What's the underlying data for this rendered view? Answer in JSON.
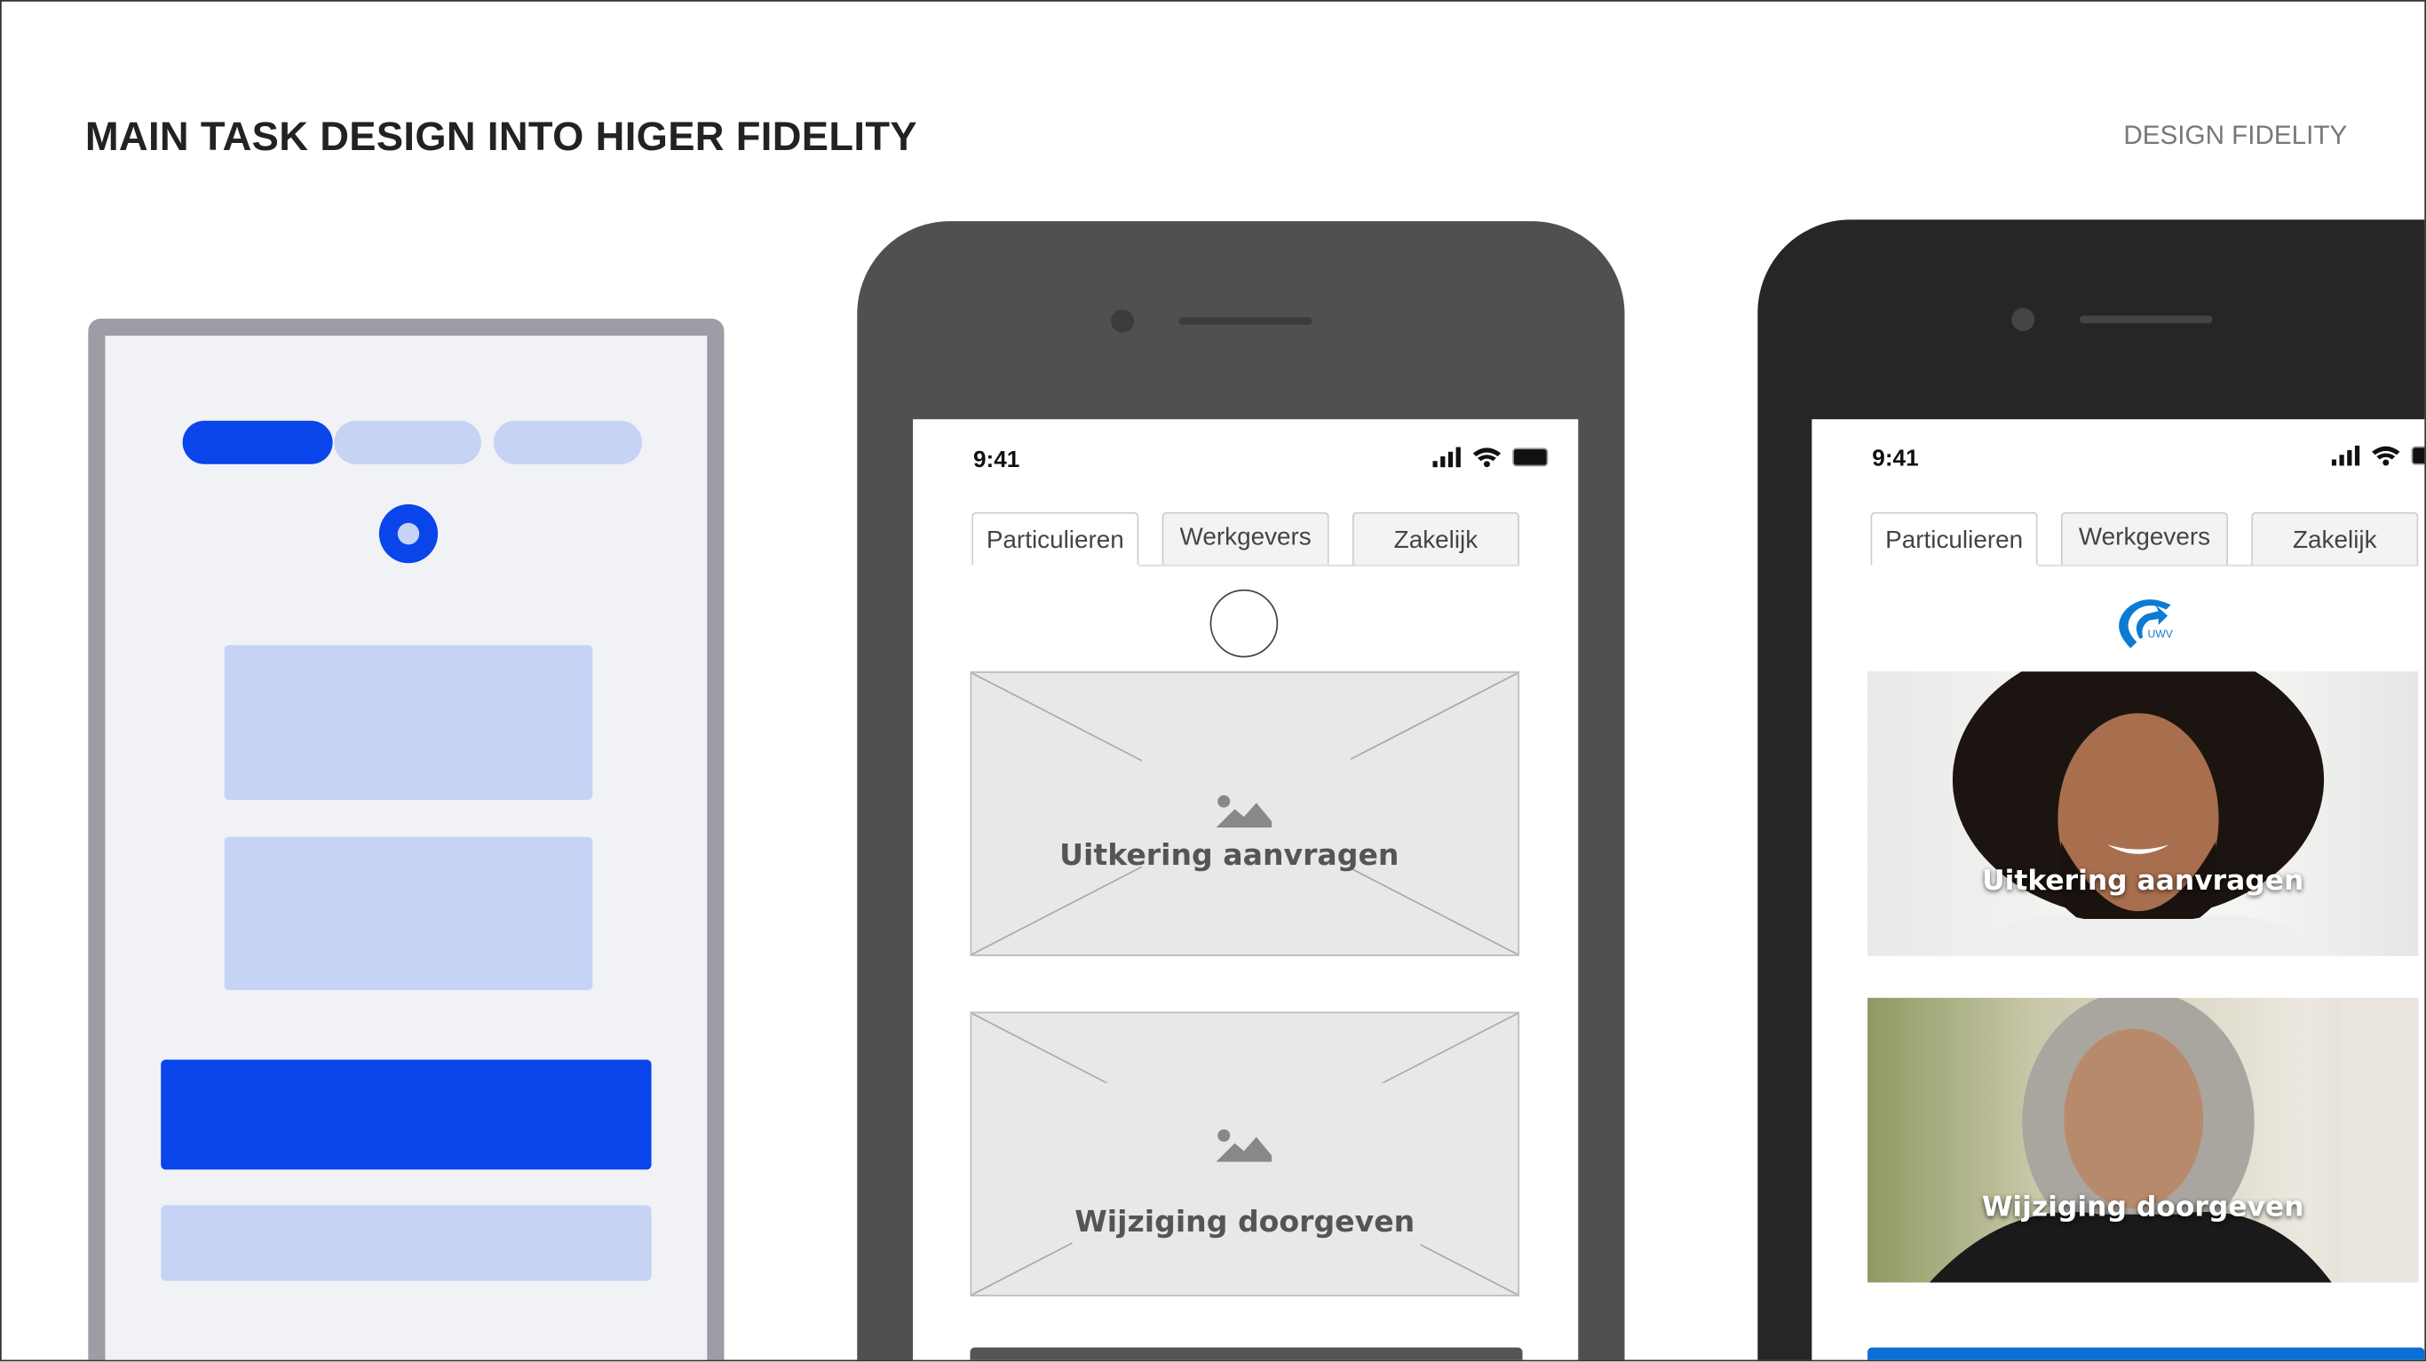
{
  "header": {
    "title": "MAIN TASK DESIGN INTO HIGER FIDELITY",
    "section": "DESIGN FIDELITY"
  },
  "colors": {
    "primary": "#0a44eb",
    "light": "#c5d3f5",
    "frame_mid": "#505050",
    "frame_dark": "#262626",
    "uwv_blue": "#0b7bd3"
  },
  "wireframe_phone": {
    "status_time": "9:41",
    "tabs": [
      "Particulieren",
      "Werkgevers",
      "Zakelijk"
    ],
    "cards": [
      "Uitkering aanvragen",
      "Wijziging doorgeven"
    ]
  },
  "hifi_phone": {
    "status_time": "9:41",
    "tabs": [
      "Particulieren",
      "Werkgevers",
      "Zakelijk"
    ],
    "logo_text": "UWV",
    "cards": [
      "Uitkering aanvragen",
      "Wijziging doorgeven"
    ]
  }
}
